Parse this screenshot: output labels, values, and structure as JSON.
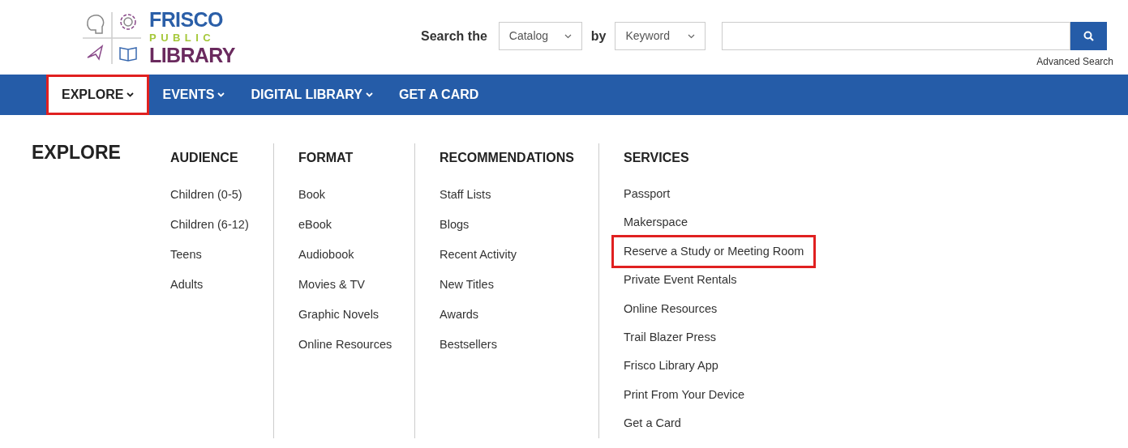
{
  "logo": {
    "lines": [
      "FRISCO",
      "PUBLIC",
      "LIBRARY"
    ]
  },
  "search": {
    "label": "Search the",
    "scope": "Catalog",
    "by_label": "by",
    "field": "Keyword",
    "advanced_link": "Advanced Search"
  },
  "nav": [
    {
      "label": "EXPLORE",
      "dropdown": true,
      "selected": true,
      "highlighted": true
    },
    {
      "label": "EVENTS",
      "dropdown": true,
      "selected": false,
      "highlighted": false
    },
    {
      "label": "DIGITAL LIBRARY",
      "dropdown": true,
      "selected": false,
      "highlighted": false
    },
    {
      "label": "GET A CARD",
      "dropdown": false,
      "selected": false,
      "highlighted": false
    }
  ],
  "menu": {
    "title": "EXPLORE",
    "columns": [
      {
        "heading": "AUDIENCE",
        "items": [
          {
            "label": "Children (0-5)",
            "highlighted": false
          },
          {
            "label": "Children (6-12)",
            "highlighted": false
          },
          {
            "label": "Teens",
            "highlighted": false
          },
          {
            "label": "Adults",
            "highlighted": false
          }
        ]
      },
      {
        "heading": "FORMAT",
        "items": [
          {
            "label": "Book",
            "highlighted": false
          },
          {
            "label": "eBook",
            "highlighted": false
          },
          {
            "label": "Audiobook",
            "highlighted": false
          },
          {
            "label": "Movies & TV",
            "highlighted": false
          },
          {
            "label": "Graphic Novels",
            "highlighted": false
          },
          {
            "label": "Online Resources",
            "highlighted": false
          }
        ]
      },
      {
        "heading": "RECOMMENDATIONS",
        "items": [
          {
            "label": "Staff Lists",
            "highlighted": false
          },
          {
            "label": "Blogs",
            "highlighted": false
          },
          {
            "label": "Recent Activity",
            "highlighted": false
          },
          {
            "label": "New Titles",
            "highlighted": false
          },
          {
            "label": "Awards",
            "highlighted": false
          },
          {
            "label": "Bestsellers",
            "highlighted": false
          }
        ]
      },
      {
        "heading": "SERVICES",
        "items": [
          {
            "label": "Passport",
            "highlighted": false
          },
          {
            "label": "Makerspace",
            "highlighted": false
          },
          {
            "label": "Reserve a Study or Meeting Room",
            "highlighted": true
          },
          {
            "label": "Private Event Rentals",
            "highlighted": false
          },
          {
            "label": "Online Resources",
            "highlighted": false
          },
          {
            "label": "Trail Blazer Press",
            "highlighted": false
          },
          {
            "label": "Frisco Library App",
            "highlighted": false
          },
          {
            "label": "Print From Your Device",
            "highlighted": false
          },
          {
            "label": "Get a Card",
            "highlighted": false
          }
        ]
      }
    ]
  }
}
